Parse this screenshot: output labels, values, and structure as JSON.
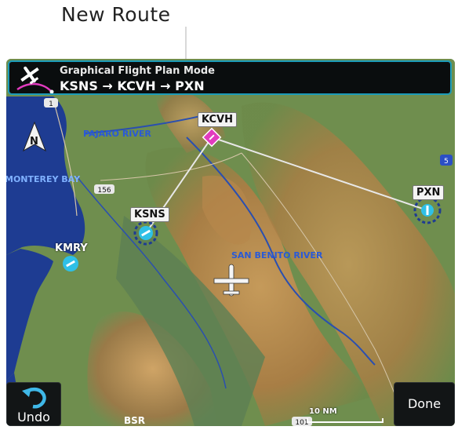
{
  "callout": {
    "text": "New Route"
  },
  "header": {
    "mode": "Graphical Flight Plan Mode",
    "route": "KSNS → KCVH → PXN"
  },
  "map": {
    "labels": {
      "monterey_bay": "MONTEREY BAY",
      "pajaro_river": "PAJARO RIVER",
      "san_benito_river": "SAN BENITO RIVER",
      "hwy_156": "156",
      "hwy_1": "1",
      "hwy_5": "5",
      "hwy_101": "101",
      "bsr": "BSR"
    },
    "north": "N",
    "scale": "10 NM"
  },
  "waypoints": [
    {
      "id": "KCVH"
    },
    {
      "id": "KSNS"
    },
    {
      "id": "PXN"
    },
    {
      "id": "KMRY"
    }
  ],
  "buttons": {
    "undo": "Undo",
    "done": "Done"
  },
  "colors": {
    "accent": "#1c9bb8",
    "route_line": "#e8e8e8",
    "waypoint_magenta": "#e23bbf",
    "water": "#1e3c92"
  }
}
